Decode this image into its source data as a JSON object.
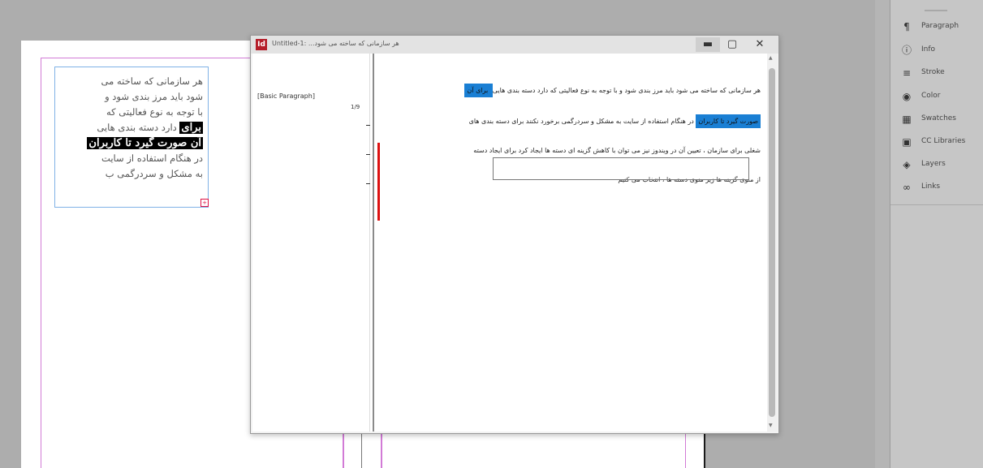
{
  "story_editor": {
    "title": "Untitled-1: ...هر سازمانی که ساخته می شود",
    "min_icon": "▬",
    "max_icon": "▢",
    "close_icon": "✕",
    "style_name": "[Basic Paragraph]",
    "depth_label": "1/9",
    "lines": {
      "l1_normal": "هر سازمانی که ساخته می شود باید مرز بندی شود و با توجه به نوع فعالیتی که دارد دسته بندی هایی",
      "l1_sel": " برای آن",
      "l2_sel": "صورت گیرد تا کاربران",
      "l2_normal": " در هنگام استفاده از سایت به مشکل و سردرگمی برخورد نکنند برای دسته بندی های",
      "l3": "شغلی برای سازمان ، تعیین آن در ویندوز نیز می توان با کاهش گزینه ای دسته ها ایجاد کرد برای ایجاد دسته",
      "l4": "از منوی گزینه ها زیر منوی دسته ها ، انتخاب می کنیم"
    }
  },
  "layout_page": {
    "frame_lines": [
      "هر سازمانی که ساخته می",
      "شود باید مرز بندی شود و",
      "با توجه به نوع فعالیتی که",
      "دارد دسته بندی هایی"
    ],
    "frame_sel_1": "برای",
    "frame_sel_2": "آن صورت گیرد تا کاربران",
    "frame_after": [
      "در هنگام استفاده از سایت",
      "به مشکل و سردرگمی ب"
    ],
    "overset_marker": "+"
  },
  "panels": [
    {
      "name": "Paragraph",
      "icon": "¶"
    },
    {
      "name": "Info",
      "icon": "ⓘ"
    },
    {
      "name": "Stroke",
      "icon": "≡"
    },
    {
      "name": "Color",
      "icon": "◉"
    },
    {
      "name": "Swatches",
      "icon": "▦"
    },
    {
      "name": "CC Libraries",
      "icon": "▣"
    },
    {
      "name": "Layers",
      "icon": "◈"
    },
    {
      "name": "Links",
      "icon": "∞"
    }
  ],
  "colors": {
    "selection": "#1a7fd4",
    "margin_guide": "#d27bd6",
    "overset": "#d11111",
    "app_icon": "#b51e2a"
  }
}
